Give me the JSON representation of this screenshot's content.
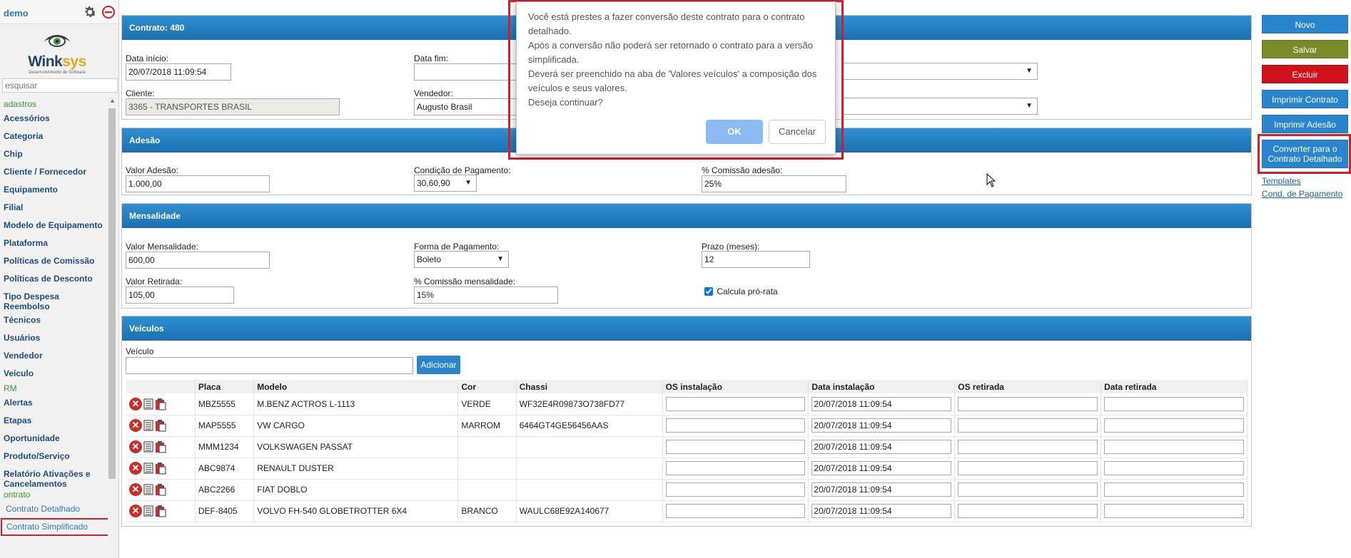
{
  "sidebar": {
    "user": "demo",
    "logo_name_prefix": "Wink",
    "logo_name_suffix": "sys",
    "logo_subtitle": "Desenvolvimento de Software",
    "search_placeholder": "esquisar",
    "menu": [
      {
        "kind": "group",
        "label": "adastros"
      },
      {
        "kind": "item",
        "label": "Acessórios"
      },
      {
        "kind": "item",
        "label": "Categoria"
      },
      {
        "kind": "item",
        "label": "Chip"
      },
      {
        "kind": "item",
        "label": "Cliente / Fornecedor"
      },
      {
        "kind": "item",
        "label": "Equipamento"
      },
      {
        "kind": "item",
        "label": "Filial"
      },
      {
        "kind": "item",
        "label": "Modelo de Equipamento"
      },
      {
        "kind": "item",
        "label": "Plataforma"
      },
      {
        "kind": "item",
        "label": "Políticas de Comissão"
      },
      {
        "kind": "item",
        "label": "Políticas de Desconto"
      },
      {
        "kind": "item",
        "label": "Tipo Despesa Reembolso"
      },
      {
        "kind": "item",
        "label": "Técnicos"
      },
      {
        "kind": "item",
        "label": "Usuários"
      },
      {
        "kind": "item",
        "label": "Vendedor"
      },
      {
        "kind": "item",
        "label": "Veículo"
      },
      {
        "kind": "group",
        "label": "RM"
      },
      {
        "kind": "item",
        "label": "Alertas"
      },
      {
        "kind": "item",
        "label": "Etapas"
      },
      {
        "kind": "item",
        "label": "Oportunidade"
      },
      {
        "kind": "item",
        "label": "Produto/Serviço"
      },
      {
        "kind": "item",
        "label": "Relatório Ativações e Cancelamentos"
      },
      {
        "kind": "group",
        "label": "ontrato"
      },
      {
        "kind": "sub",
        "label": "Contrato Detalhado"
      },
      {
        "kind": "sub",
        "label": "Contrato Simplificado",
        "selected": true
      }
    ]
  },
  "contract": {
    "title": "Contrato: 480",
    "start_label": "Data início:",
    "start_value": "20/07/2018 11:09:54",
    "end_label": "Data fim:",
    "end_value": "",
    "client_label": "Cliente:",
    "client_value": "3365 - TRANSPORTES BRASIL",
    "seller_label": "Vendedor:",
    "seller_value": "Augusto Brasil",
    "select1_value": "",
    "select2_value": ""
  },
  "adesao": {
    "title": "Adesão",
    "valor_label": "Valor Adesão:",
    "valor_value": "1.000,00",
    "condicao_label": "Condição de Pagamento:",
    "condicao_value": "30,60,90",
    "comissao_label": "% Comissão adesão:",
    "comissao_value": "25%"
  },
  "mensalidade": {
    "title": "Mensalidade",
    "valor_label": "Valor Mensalidade:",
    "valor_value": "600,00",
    "forma_label": "Forma de Pagamento:",
    "forma_value": "Boleto",
    "prazo_label": "Prazo (meses):",
    "prazo_value": "12",
    "retirada_label": "Valor Retirada:",
    "retirada_value": "105,00",
    "comissao_label": "% Comissão mensalidade:",
    "comissao_value": "15%",
    "prorata_label": "Calcula pró-rata",
    "prorata_checked": true
  },
  "veiculos": {
    "title": "Veículos",
    "veiculo_label": "Veículo",
    "veiculo_value": "",
    "add_label": "Adicionar",
    "columns": [
      "Placa",
      "Modelo",
      "Cor",
      "Chassi",
      "OS instalação",
      "Data instalação",
      "OS retirada",
      "Data retirada"
    ],
    "rows": [
      {
        "placa": "MBZ5555",
        "modelo": "M.BENZ ACTROS L-1113",
        "cor": "VERDE",
        "chassi": "WF32E4R09873O738FD77",
        "os_inst": "",
        "data_inst": "20/07/2018 11:09:54",
        "os_ret": "",
        "data_ret": ""
      },
      {
        "placa": "MAP5555",
        "modelo": "VW CARGO",
        "cor": "MARROM",
        "chassi": "6464GT4GE56456AAS",
        "os_inst": "",
        "data_inst": "20/07/2018 11:09:54",
        "os_ret": "",
        "data_ret": ""
      },
      {
        "placa": "MMM1234",
        "modelo": "VOLKSWAGEN PASSAT",
        "cor": "",
        "chassi": "",
        "os_inst": "",
        "data_inst": "20/07/2018 11:09:54",
        "os_ret": "",
        "data_ret": ""
      },
      {
        "placa": "ABC9874",
        "modelo": "RENAULT DUSTER",
        "cor": "",
        "chassi": "",
        "os_inst": "",
        "data_inst": "20/07/2018 11:09:54",
        "os_ret": "",
        "data_ret": ""
      },
      {
        "placa": "ABC2266",
        "modelo": "FIAT DOBLO",
        "cor": "",
        "chassi": "",
        "os_inst": "",
        "data_inst": "20/07/2018 11:09:54",
        "os_ret": "",
        "data_ret": ""
      },
      {
        "placa": "DEF-8405",
        "modelo": "VOLVO FH-540 GLOBETROTTER 6X4",
        "cor": "BRANCO",
        "chassi": "WAULC68E92A140677",
        "os_inst": "",
        "data_inst": "20/07/2018 11:09:54",
        "os_ret": "",
        "data_ret": ""
      }
    ]
  },
  "actions": {
    "novo": "Novo",
    "salvar": "Salvar",
    "excluir": "Excluir",
    "imprimir_contrato": "Imprimir Contrato",
    "imprimir_adesao": "Imprimir Adesão",
    "converter": "Converter para o Contrato Detalhado",
    "templates": "Templates",
    "cond_pagamento": "Cond. de Pagamento"
  },
  "dialog": {
    "lines": [
      "Você está prestes a fazer conversão deste contrato para o contrato detalhado.",
      "Após a conversão não poderá ser retornado o contrato para a versão simplificada.",
      "Deverá ser preenchido na aba de 'Valores veículos' a composição dos veículos e seus valores.",
      "Deseja continuar?"
    ],
    "ok": "OK",
    "cancel": "Cancelar"
  },
  "colors": {
    "header_blue": "#1b6fb0",
    "btn_novo": "#2a86cc",
    "btn_salvar": "#7c8c2a",
    "btn_excluir": "#d0121b",
    "highlight_red": "#d02030",
    "ok_button": "#8bbbf2"
  }
}
